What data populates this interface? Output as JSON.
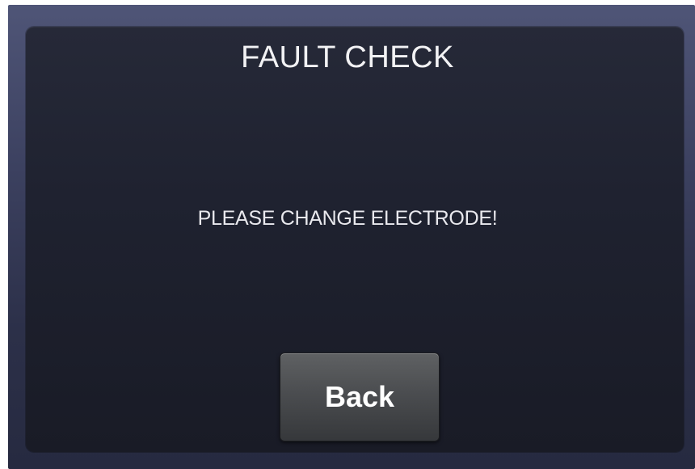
{
  "dialog": {
    "title": "FAULT CHECK",
    "message": "PLEASE CHANGE ELECTRODE!",
    "back_label": "Back"
  }
}
